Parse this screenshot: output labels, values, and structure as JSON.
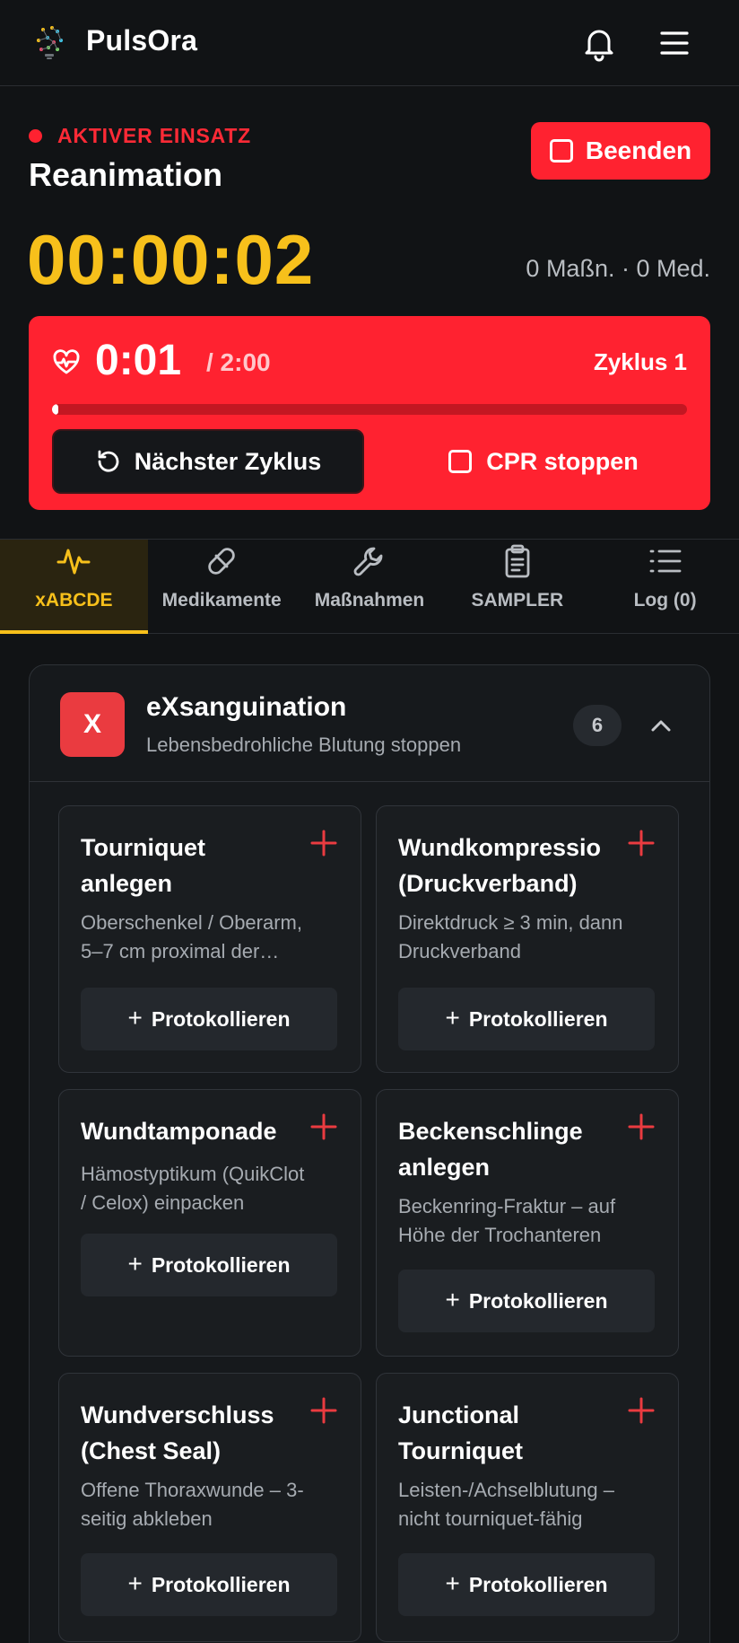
{
  "app": {
    "title": "PulsOra"
  },
  "header": {
    "logo_icon": "brain-network-icon",
    "bell_icon": "bell-icon",
    "menu_icon": "hamburger-menu-icon"
  },
  "mission": {
    "status": "AKTIVER EINSATZ",
    "title": "Reanimation",
    "end_label": "Beenden",
    "timer": "00:00:02",
    "counts": "0 Maßn. · 0 Med."
  },
  "cpr": {
    "elapsed": "0:01",
    "total": "/ 2:00",
    "cycle": "Zyklus 1",
    "progress_fraction": 0.008,
    "next_label": "Nächster Zyklus",
    "stop_label": "CPR stoppen"
  },
  "tabs": [
    {
      "label": "xABCDE",
      "icon": "pulse-icon",
      "active": true
    },
    {
      "label": "Medikamente",
      "icon": "pill-icon",
      "active": false
    },
    {
      "label": "Maßnahmen",
      "icon": "wrench-icon",
      "active": false
    },
    {
      "label": "SAMPLER",
      "icon": "clipboard-icon",
      "active": false
    },
    {
      "label": "Log (0)",
      "icon": "list-icon",
      "active": false
    }
  ],
  "section": {
    "badge": "X",
    "title": "eXsanguination",
    "subtitle": "Lebensbedrohliche Blutung stoppen",
    "count": "6",
    "items": [
      {
        "title_line1": "Tourniquet",
        "title_line2": "anlegen",
        "desc_line1": "Oberschenkel / Oberarm,",
        "desc_line2": "5–7 cm proximal der…",
        "action": "Protokollieren"
      },
      {
        "title_line1": "Wundkompressio",
        "title_line2": "(Druckverband)",
        "desc_line1": "Direktdruck ≥ 3 min, dann",
        "desc_line2": "Druckverband",
        "action": "Protokollieren"
      },
      {
        "title_line1": "Wundtamponade",
        "title_line2": "",
        "desc_line1": "Hämostyptikum (QuikClot",
        "desc_line2": "/ Celox) einpacken",
        "action": "Protokollieren"
      },
      {
        "title_line1": "Beckenschlinge",
        "title_line2": "anlegen",
        "desc_line1": "Beckenring-Fraktur – auf",
        "desc_line2": "Höhe der Trochanteren",
        "action": "Protokollieren"
      },
      {
        "title_line1": "Wundverschluss",
        "title_line2": "(Chest Seal)",
        "desc_line1": "Offene Thoraxwunde – 3-",
        "desc_line2": "seitig abkleben",
        "action": "Protokollieren"
      },
      {
        "title_line1": "Junctional",
        "title_line2": "Tourniquet",
        "desc_line1": "Leisten-/Achselblutung –",
        "desc_line2": "nicht tourniquet-fähig",
        "action": "Protokollieren"
      }
    ]
  },
  "colors": {
    "accent_red": "#ff2230",
    "accent_yellow": "#f7c01b",
    "background": "#111315"
  }
}
